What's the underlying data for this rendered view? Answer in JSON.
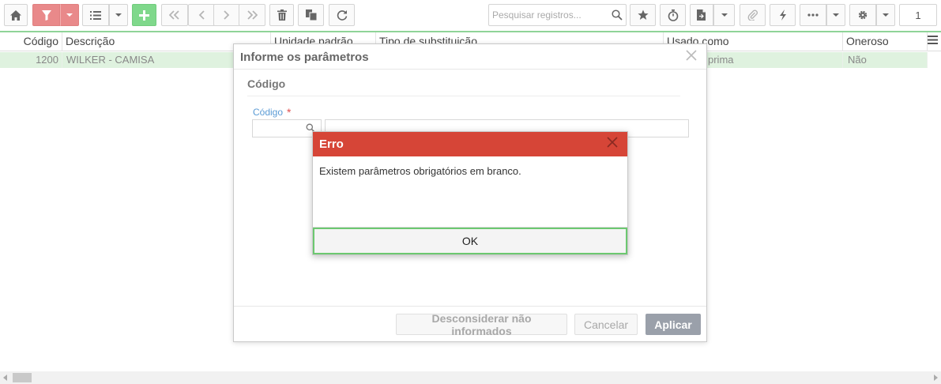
{
  "toolbar": {
    "icons": [
      "home-icon",
      "filter-icon",
      "list-icon",
      "plus-icon",
      "first-page-icon",
      "prev-page-icon",
      "next-page-icon",
      "last-page-icon",
      "trash-icon",
      "copy-icon",
      "refresh-icon",
      "search-icon",
      "star-icon",
      "stopwatch-icon",
      "report-icon",
      "paperclip-icon",
      "lightning-icon",
      "more-icon",
      "gear-icon"
    ],
    "search_placeholder": "Pesquisar registros...",
    "page_number": "1",
    "accent_filter": "#e9898a",
    "accent_add": "#7fd88b"
  },
  "grid": {
    "columns": [
      "Código",
      "Descrição",
      "Unidade padrão",
      "Tipo de substituição",
      "Usado como",
      "Oneroso"
    ],
    "rows": [
      {
        "codigo": "1200",
        "descricao": "WILKER - CAMISA",
        "usado_como": "prima",
        "oneroso": "Não"
      }
    ],
    "selected_row_color": "#dff2df"
  },
  "params_dialog": {
    "title": "Informe os parâmetros",
    "section_title": "Código",
    "field_label": "Código",
    "required_mark": "*",
    "code_value": "",
    "description_value": "",
    "buttons": {
      "ignore": "Desconsiderar não informados",
      "cancel": "Cancelar",
      "apply": "Aplicar"
    }
  },
  "error_dialog": {
    "title": "Erro",
    "message": "Existem parâmetros obrigatórios em branco.",
    "ok_label": "OK",
    "header_color": "#d64537"
  }
}
